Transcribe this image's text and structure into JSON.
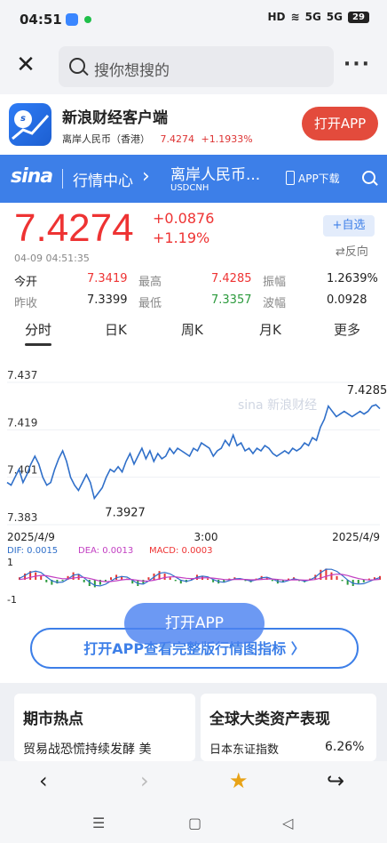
{
  "status": {
    "time": "04:51",
    "hd": "HD",
    "net1": "5G",
    "net2": "5G",
    "battery": "29"
  },
  "search": {
    "placeholder": "搜你想搜的",
    "more": "···"
  },
  "banner": {
    "app_name": "新浪财经客户端",
    "currency": "离岸人民币（香港）",
    "price": "7.4274",
    "change": "+1.1933%",
    "open_button": "打开APP",
    "logo": "sina-logo"
  },
  "nav": {
    "brand": "sina",
    "center": "行情中心",
    "name": "离岸人民币...",
    "code": "USDCNH",
    "download": "APP下载"
  },
  "quote": {
    "price": "7.4274",
    "change_abs": "+0.0876",
    "change_pct": "+1.19%",
    "watch": "+自选",
    "reverse": "⇄反向",
    "timestamp": "04-09   04:51:35",
    "stats": [
      {
        "label": "今开",
        "value": "7.3419",
        "color": "red"
      },
      {
        "label": "最高",
        "value": "7.4285",
        "color": "red"
      },
      {
        "label": "振幅",
        "value": "1.2639%",
        "color": "dark"
      },
      {
        "label": "昨收",
        "value": "7.3399",
        "color": "dark"
      },
      {
        "label": "最低",
        "value": "7.3357",
        "color": "green"
      },
      {
        "label": "波幅",
        "value": "0.0928",
        "color": "dark"
      }
    ]
  },
  "tabs": [
    "分时",
    "日K",
    "周K",
    "月K",
    "更多"
  ],
  "chart_data": {
    "type": "line",
    "y_ticks": [
      "7.437",
      "7.419",
      "7.401",
      "7.383"
    ],
    "ylim": [
      7.383,
      7.437
    ],
    "x_labels": [
      "2025/4/9",
      "3:00",
      "2025/4/9"
    ],
    "annotations": {
      "high": "7.4285",
      "low": "7.3927"
    },
    "series": [
      {
        "values": [
          7.399,
          7.398,
          7.401,
          7.404,
          7.399,
          7.402,
          7.406,
          7.409,
          7.406,
          7.401,
          7.398,
          7.399,
          7.404,
          7.408,
          7.411,
          7.407,
          7.401,
          7.398,
          7.396,
          7.399,
          7.402,
          7.399,
          7.393,
          7.395,
          7.397,
          7.401,
          7.404,
          7.403,
          7.405,
          7.403,
          7.407,
          7.41,
          7.406,
          7.409,
          7.412,
          7.408,
          7.411,
          7.407,
          7.41,
          7.408,
          7.409,
          7.412,
          7.41,
          7.412,
          7.411,
          7.41,
          7.409,
          7.412,
          7.411,
          7.414,
          7.413,
          7.412,
          7.409,
          7.411,
          7.412,
          7.415,
          7.413,
          7.417,
          7.413,
          7.414,
          7.411,
          7.412,
          7.41,
          7.412,
          7.411,
          7.413,
          7.412,
          7.41,
          7.409,
          7.41,
          7.411,
          7.41,
          7.412,
          7.411,
          7.412,
          7.414,
          7.413,
          7.416,
          7.415,
          7.42,
          7.423,
          7.428,
          7.426,
          7.424,
          7.425,
          7.426,
          7.425,
          7.424,
          7.425,
          7.426,
          7.425,
          7.426,
          7.428,
          7.4285,
          7.427
        ]
      }
    ],
    "macd": {
      "dif": "DIF: 0.0015",
      "dea": "DEA: 0.0013",
      "macd": "MACD: 0.0003",
      "y_top": "1",
      "y_bottom": "-1",
      "hist": [
        0.2,
        0.5,
        0.7,
        0.6,
        0.3,
        -0.2,
        -0.4,
        -0.3,
        -0.1,
        0.3,
        0.6,
        0.4,
        -0.2,
        -0.5,
        -0.6,
        -0.4,
        -0.1,
        0.2,
        0.4,
        0.3,
        0.1,
        -0.3,
        -0.5,
        -0.3,
        0.2,
        0.5,
        0.7,
        0.5,
        0.2,
        -0.1,
        -0.3,
        -0.2,
        0.1,
        0.4,
        0.3,
        0.1,
        -0.2,
        -0.3,
        -0.2,
        0.1,
        0.2,
        0.1,
        -0.1,
        -0.2,
        0.1,
        0.3,
        0.2,
        -0.1,
        -0.3,
        -0.2,
        0.1,
        0.2,
        -0.1,
        -0.2,
        0.1,
        0.4,
        0.8,
        0.9,
        0.6,
        0.3,
        -0.1,
        -0.4,
        -0.5,
        -0.3,
        -0.2,
        0.1,
        0.2,
        0.3
      ]
    }
  },
  "overlay_button": "打开APP",
  "full_button": "打开APP查看完整版行情图指标 〉",
  "cards": [
    {
      "title": "期市热点",
      "text": "贸易战恐慌持续发酵 美"
    },
    {
      "title": "全球大类资产表现",
      "text": "日本东证指数",
      "value": "6.26%"
    }
  ],
  "browser": {
    "back": "‹",
    "forward": "›",
    "star": "★",
    "share": "↪"
  },
  "system": {
    "menu": "☰",
    "home": "▢",
    "back": "◁"
  },
  "colors": {
    "up": "#e33333",
    "down": "#2b9a3c",
    "brand": "#3d7fe8",
    "line": "#2f6fc9"
  }
}
